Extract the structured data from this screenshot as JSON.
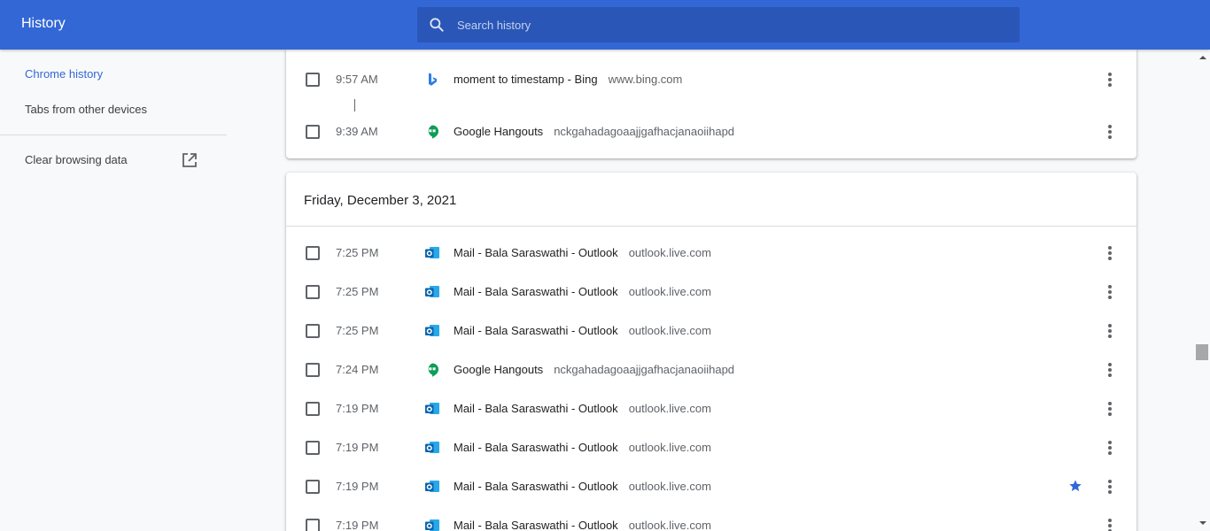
{
  "header": {
    "title": "History",
    "search_placeholder": "Search history"
  },
  "sidebar": {
    "chrome_history": "Chrome history",
    "tabs_other_devices": "Tabs from other devices",
    "clear_browsing_data": "Clear browsing data"
  },
  "group1": {
    "items": [
      {
        "time": "9:57 AM",
        "title": "moment to timestamp - Bing",
        "domain": "www.bing.com",
        "icon": "bing-icon"
      },
      {
        "time": "9:39 AM",
        "title": "Google Hangouts",
        "domain": "nckgahadagoaajjgafhacjanaoiihapd",
        "icon": "hangouts-icon"
      }
    ]
  },
  "group2": {
    "date": "Friday, December 3, 2021",
    "items": [
      {
        "time": "7:25 PM",
        "title": "Mail - Bala Saraswathi - Outlook",
        "domain": "outlook.live.com",
        "icon": "outlook-icon"
      },
      {
        "time": "7:25 PM",
        "title": "Mail - Bala Saraswathi - Outlook",
        "domain": "outlook.live.com",
        "icon": "outlook-icon"
      },
      {
        "time": "7:25 PM",
        "title": "Mail - Bala Saraswathi - Outlook",
        "domain": "outlook.live.com",
        "icon": "outlook-icon"
      },
      {
        "time": "7:24 PM",
        "title": "Google Hangouts",
        "domain": "nckgahadagoaajjgafhacjanaoiihapd",
        "icon": "hangouts-icon"
      },
      {
        "time": "7:19 PM",
        "title": "Mail - Bala Saraswathi - Outlook",
        "domain": "outlook.live.com",
        "icon": "outlook-icon"
      },
      {
        "time": "7:19 PM",
        "title": "Mail - Bala Saraswathi - Outlook",
        "domain": "outlook.live.com",
        "icon": "outlook-icon"
      },
      {
        "time": "7:19 PM",
        "title": "Mail - Bala Saraswathi - Outlook",
        "domain": "outlook.live.com",
        "icon": "outlook-icon",
        "starred": true
      },
      {
        "time": "7:19 PM",
        "title": "Mail - Bala Saraswathi - Outlook",
        "domain": "outlook.live.com",
        "icon": "outlook-icon"
      }
    ]
  },
  "colors": {
    "header_bg": "#3367d6",
    "search_bg": "#2a56b8",
    "accent": "#3367d6",
    "outlook": "#0a64ad",
    "hangouts": "#0f9d58",
    "bing": "#2b7de9"
  }
}
